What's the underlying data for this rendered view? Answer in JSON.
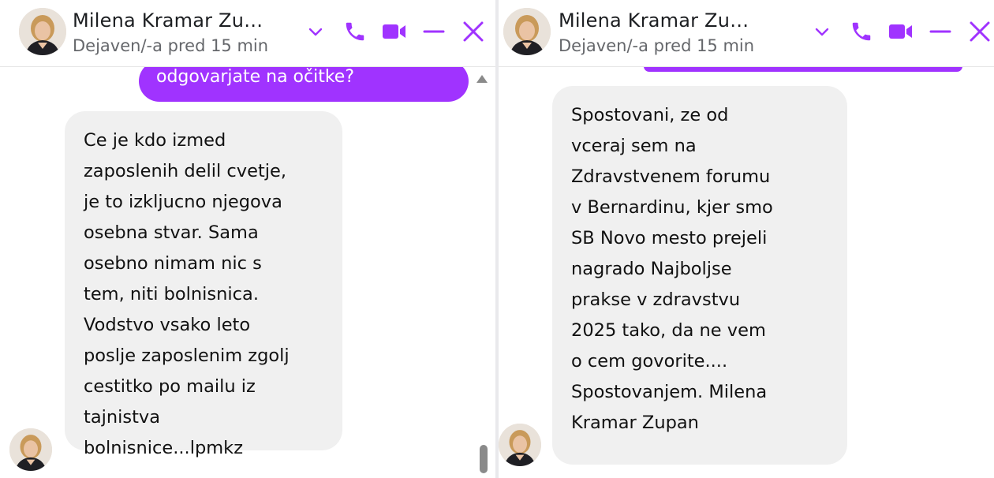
{
  "left": {
    "header": {
      "name": "Milena Kramar Zu…",
      "status": "Dejaven/-a pred 15 min"
    },
    "outgoing_partial": "odgovarjate na očitke?",
    "incoming": "Ce je kdo izmed\nzaposlenih delil cvetje,\nje to izkljucno njegova\nosebna stvar. Sama\nosebno nimam nic s\ntem, niti bolnisnica.\nVodstvo vsako leto\nposlje zaposlenim zgolj\ncestitko po mailu iz\ntajnistva\nbolnisnice...lpmkz"
  },
  "right": {
    "header": {
      "name": "Milena Kramar Zu…",
      "status": "Dejaven/-a pred 15 min"
    },
    "incoming": "Spostovani, ze od\nvceraj sem na\nZdravstvenem forumu\nv Bernardinu, kjer smo\nSB Novo mesto prejeli\nnagrado Najboljse\nprakse v zdravstvu\n2025  tako, da ne vem\no cem govorite....\nSpostovanjem. Milena\nKramar Zupan"
  },
  "icons": [
    "chevron-down-icon",
    "phone-icon",
    "video-camera-icon",
    "minimize-icon",
    "close-icon"
  ],
  "colors": {
    "accent": "#a033ff",
    "incoming_bubble": "#f0f0f0",
    "status_text": "#65676b"
  }
}
